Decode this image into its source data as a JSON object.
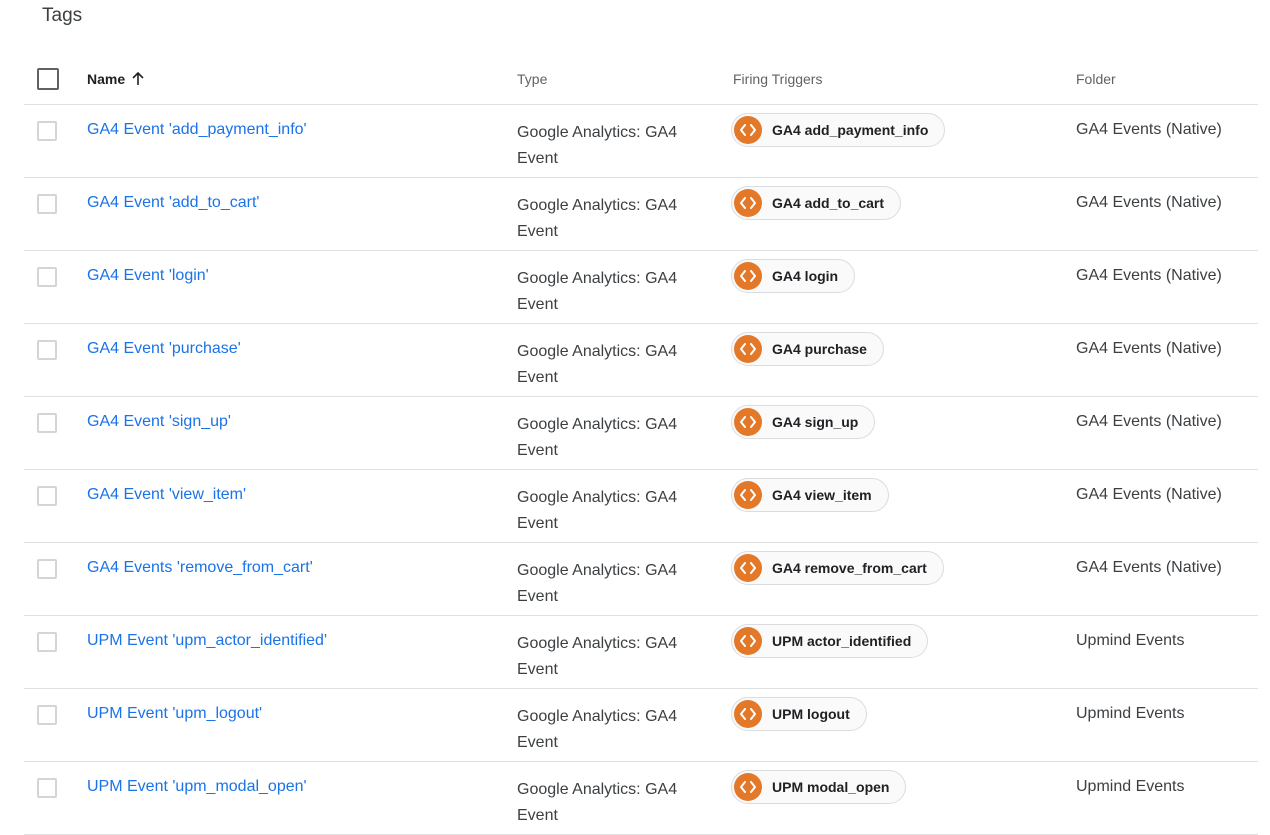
{
  "page": {
    "title": "Tags"
  },
  "table": {
    "headers": {
      "name": "Name",
      "type": "Type",
      "triggers": "Firing Triggers",
      "folder": "Folder"
    },
    "sort": {
      "column": "name",
      "direction": "ascending",
      "icon": "arrow-up-icon"
    },
    "trigger_icon": "custom-event-code-icon",
    "accent_color": "#e37828",
    "link_color": "#1a73e8",
    "rows": [
      {
        "name": "GA4 Event 'add_payment_info'",
        "type_line1": "Google Analytics: GA4",
        "type_line2": "Event",
        "trigger": "GA4 add_payment_info",
        "folder": "GA4 Events (Native)"
      },
      {
        "name": "GA4 Event 'add_to_cart'",
        "type_line1": "Google Analytics: GA4",
        "type_line2": "Event",
        "trigger": "GA4 add_to_cart",
        "folder": "GA4 Events (Native)"
      },
      {
        "name": "GA4 Event 'login'",
        "type_line1": "Google Analytics: GA4",
        "type_line2": "Event",
        "trigger": "GA4 login",
        "folder": "GA4 Events (Native)"
      },
      {
        "name": "GA4 Event 'purchase'",
        "type_line1": "Google Analytics: GA4",
        "type_line2": "Event",
        "trigger": "GA4 purchase",
        "folder": "GA4 Events (Native)"
      },
      {
        "name": "GA4 Event 'sign_up'",
        "type_line1": "Google Analytics: GA4",
        "type_line2": "Event",
        "trigger": "GA4 sign_up",
        "folder": "GA4 Events (Native)"
      },
      {
        "name": "GA4 Event 'view_item'",
        "type_line1": "Google Analytics: GA4",
        "type_line2": "Event",
        "trigger": "GA4 view_item",
        "folder": "GA4 Events (Native)"
      },
      {
        "name": "GA4 Events 'remove_from_cart'",
        "type_line1": "Google Analytics: GA4",
        "type_line2": "Event",
        "trigger": "GA4 remove_from_cart",
        "folder": "GA4 Events (Native)"
      },
      {
        "name": "UPM Event 'upm_actor_identified'",
        "type_line1": "Google Analytics: GA4",
        "type_line2": "Event",
        "trigger": "UPM actor_identified",
        "folder": "Upmind Events"
      },
      {
        "name": "UPM Event 'upm_logout'",
        "type_line1": "Google Analytics: GA4",
        "type_line2": "Event",
        "trigger": "UPM logout",
        "folder": "Upmind Events"
      },
      {
        "name": "UPM Event 'upm_modal_open'",
        "type_line1": "Google Analytics: GA4",
        "type_line2": "Event",
        "trigger": "UPM modal_open",
        "folder": "Upmind Events"
      }
    ]
  }
}
